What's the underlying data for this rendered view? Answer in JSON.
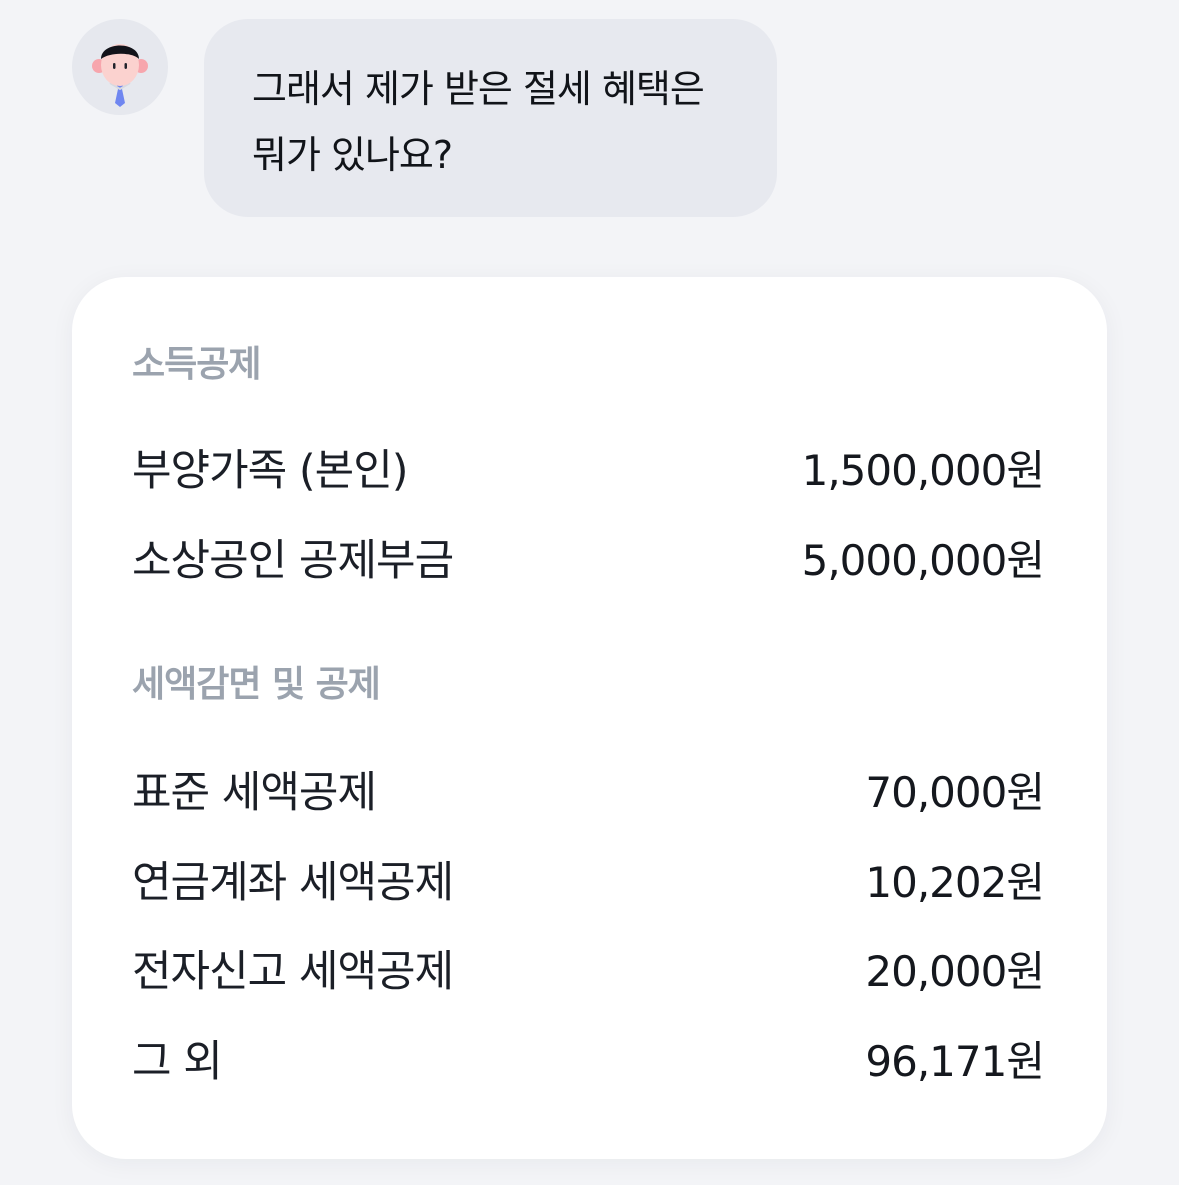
{
  "chat": {
    "avatar_icon": "person-avatar-icon",
    "message_line1": "그래서 제가 받은 절세 혜택은",
    "message_line2": "뭐가 있나요?"
  },
  "income_deduction": {
    "title": "소득공제",
    "items": [
      {
        "label": "부양가족 (본인)",
        "amount": "1,500,000원"
      },
      {
        "label": "소상공인 공제부금",
        "amount": "5,000,000원"
      }
    ]
  },
  "tax_credit": {
    "title": "세액감면 및 공제",
    "items": [
      {
        "label": "표준 세액공제",
        "amount": "70,000원"
      },
      {
        "label": "연금계좌 세액공제",
        "amount": "10,202원"
      },
      {
        "label": "전자신고 세액공제",
        "amount": "20,000원"
      },
      {
        "label": "그 외",
        "amount": "96,171원"
      }
    ]
  },
  "colors": {
    "page_bg": "#f3f4f7",
    "bubble_bg": "#e7e9ef",
    "card_bg": "#ffffff",
    "section_title": "#9ba3ae",
    "text": "#1b1f27"
  }
}
